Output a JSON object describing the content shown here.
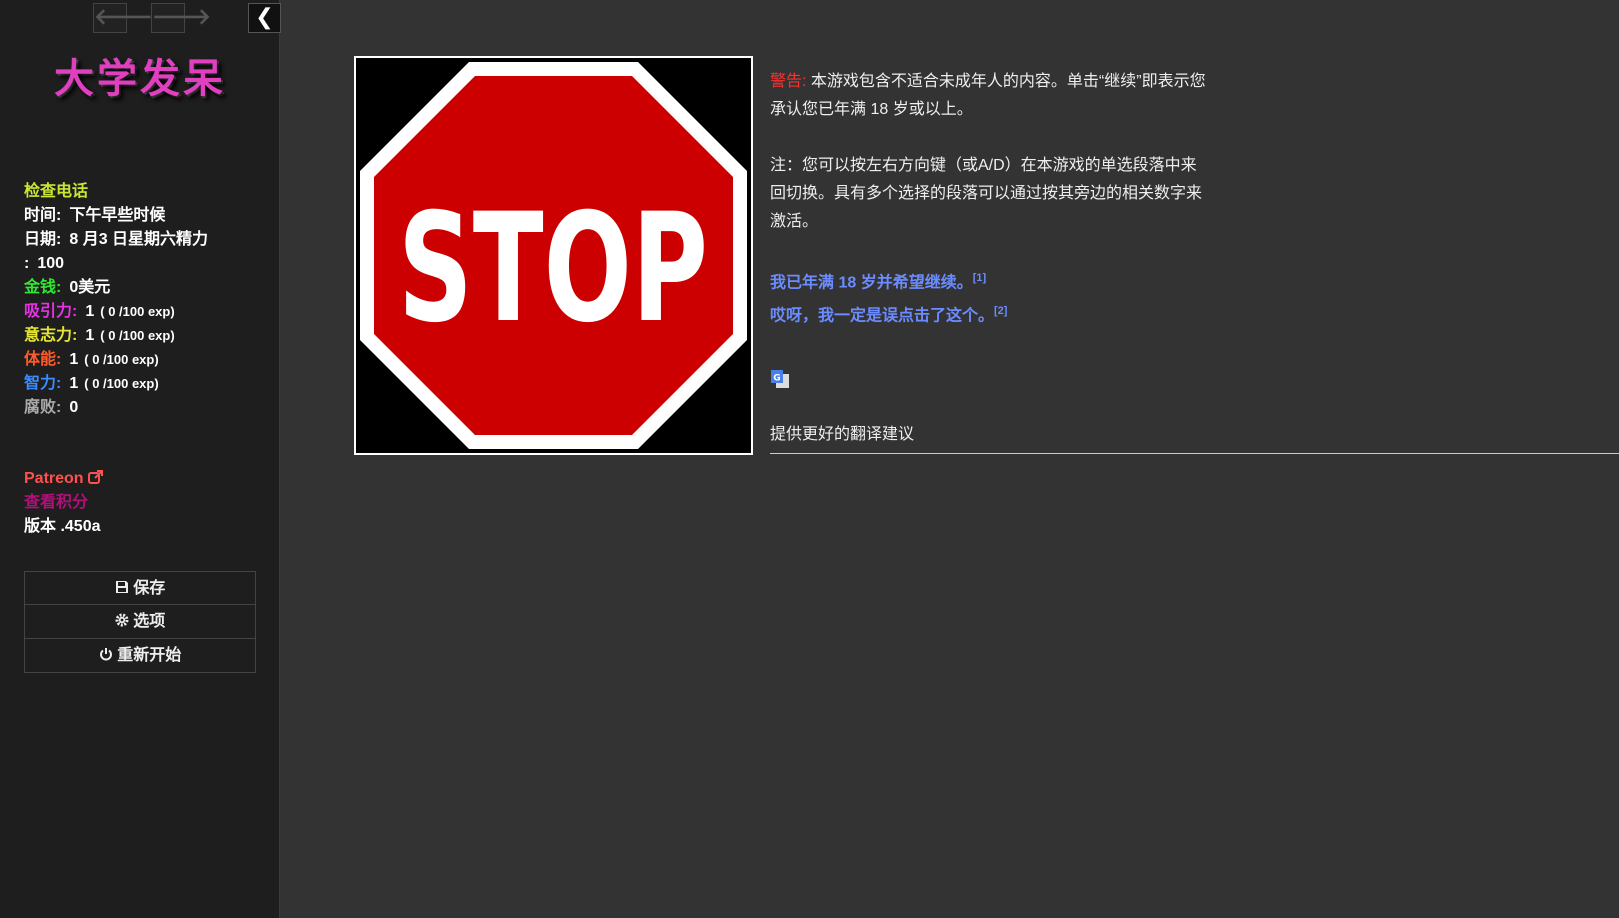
{
  "sidebar": {
    "title": "大学发呆",
    "stats": [
      {
        "label": "检查电话",
        "value": "",
        "color": "#c8e632"
      },
      {
        "label": "时间:",
        "value": "下午早些时候",
        "color": "#ffffff"
      },
      {
        "label": "日期:",
        "value": "8 月3 日星期六精力",
        "color": "#ffffff"
      },
      {
        "label": ":",
        "value": "100",
        "color": "#ffffff"
      },
      {
        "label": "金钱:",
        "value": "0美元",
        "color": "#32e632"
      },
      {
        "label": "吸引力:",
        "value": "1",
        "exp": "( 0 /100 exp)",
        "color": "#e632e6"
      },
      {
        "label": "意志力:",
        "value": "1",
        "exp": "( 0 /100 exp)",
        "color": "#e6e632"
      },
      {
        "label": "体能:",
        "value": "1",
        "exp": "( 0 /100 exp)",
        "color": "#ff5a2a"
      },
      {
        "label": "智力:",
        "value": "1",
        "exp": "( 0 /100 exp)",
        "color": "#3a8cff"
      },
      {
        "label": "腐败:",
        "value": "0",
        "color": "#aaaaaa"
      }
    ],
    "links": {
      "patreon": "Patreon",
      "patreon_color": "#ff5050",
      "scores": "查看积分",
      "scores_color": "#b0107a",
      "version": "版本 .450a"
    },
    "menu": {
      "save": "保存",
      "options": "选项",
      "restart": "重新开始"
    }
  },
  "passage": {
    "image_text": "STOP",
    "warning_label": "警告:",
    "warning_color": "#ff3030",
    "warning_text": "本游戏包含不适合未成年人的内容。单击“继续”即表示您承认您已年满 18 岁或以上。",
    "note_text": "注：您可以按左右方向键（或A/D）在本游戏的单选段落中来回切换。具有多个选择的段落可以通过按其旁边的相关数字来激活。",
    "choices": [
      {
        "text": "我已年满 18 岁并希望继续。",
        "num": "[1]"
      },
      {
        "text": "哎呀，我一定是误点击了这个。",
        "num": "[2]"
      }
    ],
    "choice_color": "#6b8cff"
  },
  "translate": {
    "suggest": "提供更好的翻译建议"
  }
}
